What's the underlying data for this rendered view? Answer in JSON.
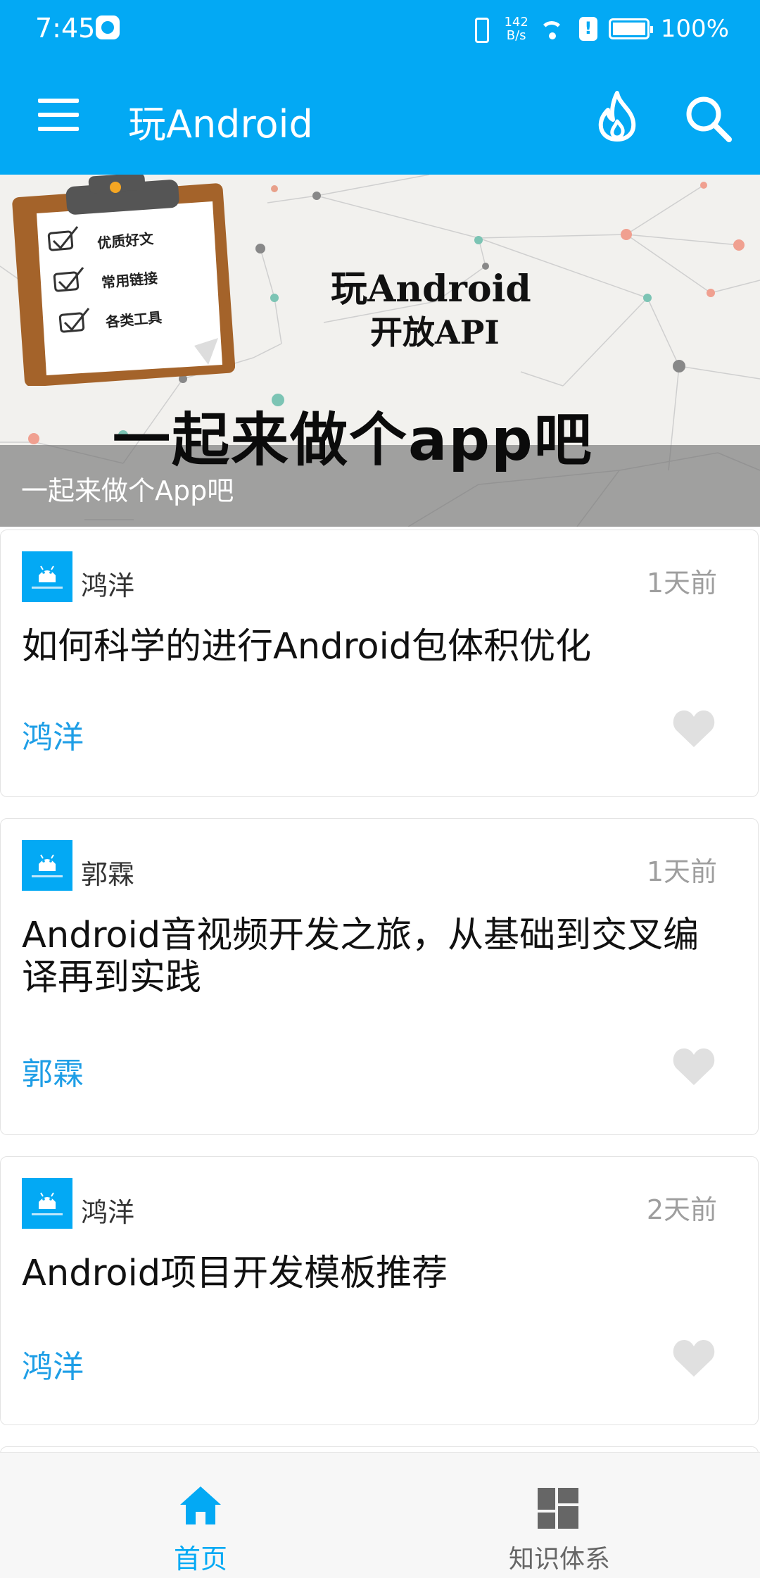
{
  "status_bar": {
    "time": "7:45",
    "net_speed_value": "142",
    "net_speed_unit": "B/s",
    "battery": "100%"
  },
  "app_bar": {
    "title": "玩Android",
    "icons": [
      "menu-icon",
      "fire-icon",
      "search-icon"
    ]
  },
  "banner": {
    "caption": "一起来做个App吧",
    "image_text": {
      "title_line1": "玩Android",
      "title_line2": "开放API",
      "slogan": "一起来做个app吧",
      "clipboard_items": [
        "优质好文",
        "常用链接",
        "各类工具"
      ]
    }
  },
  "articles": [
    {
      "author": "鸿洋",
      "time": "1天前",
      "title": "如何科学的进行Android包体积优化",
      "link_author": "鸿洋"
    },
    {
      "author": "郭霖",
      "time": "1天前",
      "title": "Android音视频开发之旅，从基础到交叉编译再到实践",
      "link_author": "郭霖"
    },
    {
      "author": "鸿洋",
      "time": "2天前",
      "title": "Android项目开发模板推荐",
      "link_author": "鸿洋"
    }
  ],
  "bottom_nav": {
    "items": [
      {
        "label": "首页",
        "icon": "home-icon",
        "active": true
      },
      {
        "label": "知识体系",
        "icon": "dashboard-icon",
        "active": false
      }
    ]
  },
  "colors": {
    "primary": "#03a9f4",
    "link": "#1e9ee6",
    "meta_gray": "#9e9e9e",
    "heart_gray": "#e0e0e0"
  }
}
